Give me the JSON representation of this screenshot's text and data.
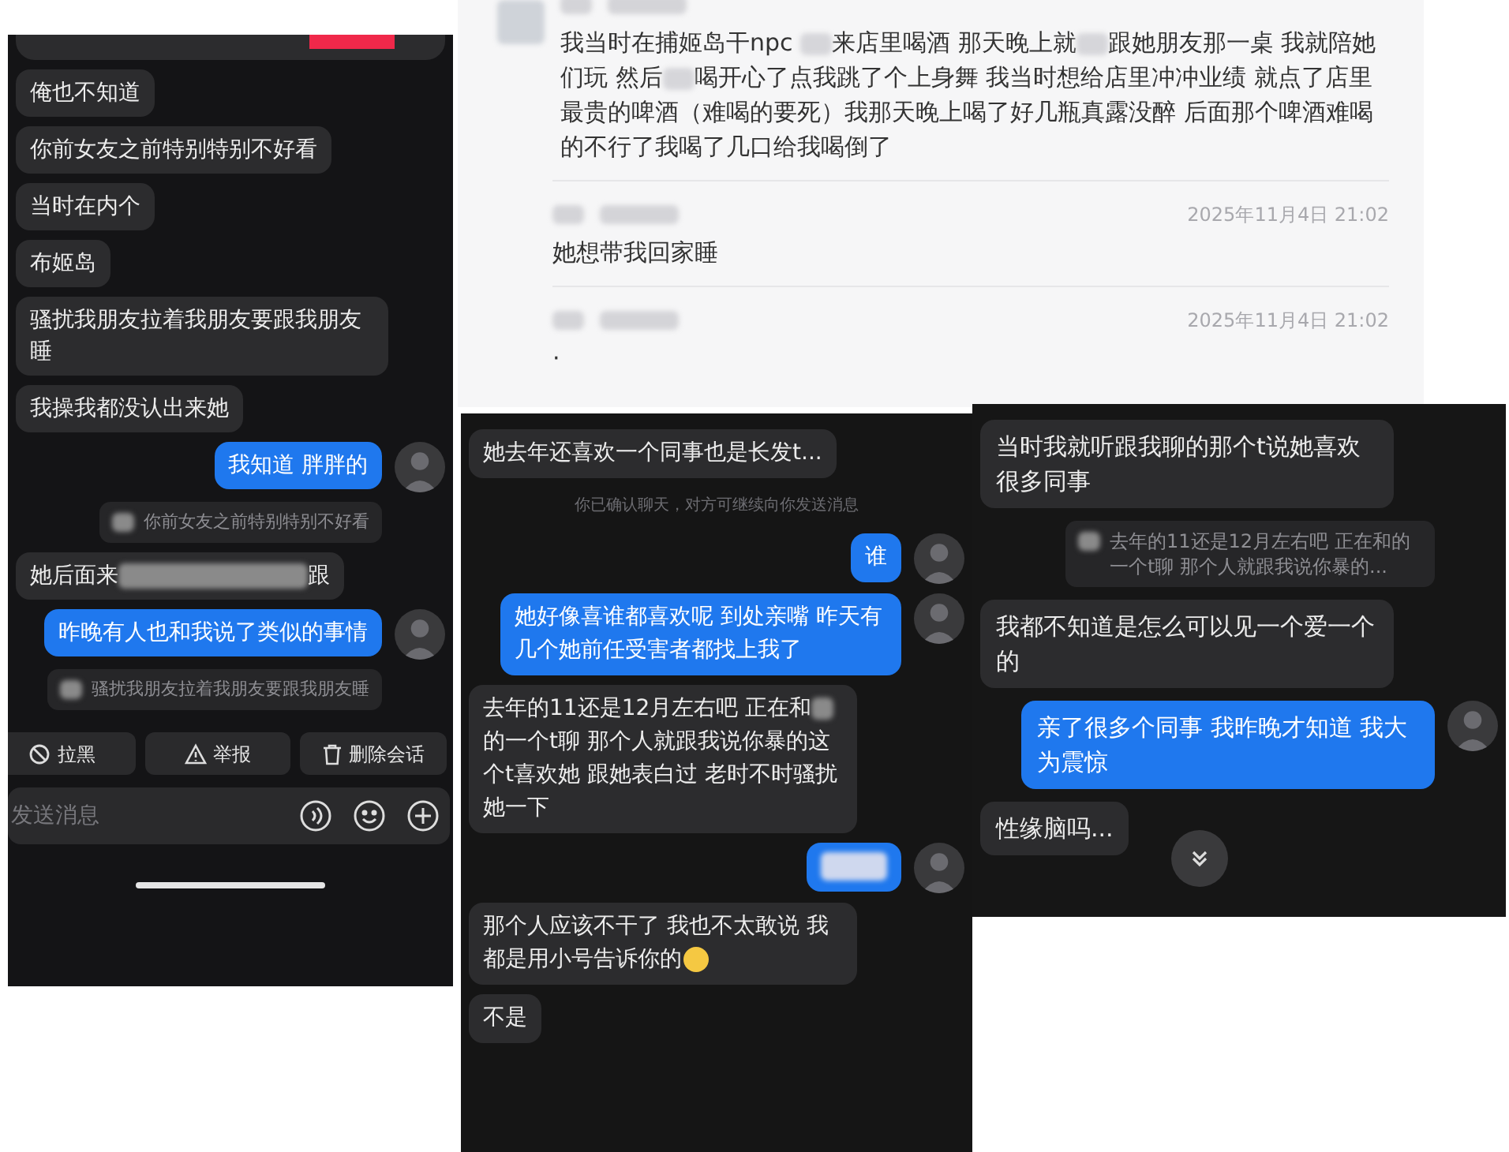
{
  "panels": [
    {
      "kind": "phone_chat",
      "messages": [
        {
          "kind": "cut_off"
        },
        {
          "kind": "incoming",
          "segments": [
            {
              "kind": "text",
              "text": "俺也不知道"
            }
          ]
        },
        {
          "kind": "incoming",
          "segments": [
            {
              "kind": "text",
              "text": "你前女友之前特别特别不好看"
            }
          ]
        },
        {
          "kind": "incoming",
          "segments": [
            {
              "kind": "text",
              "text": "当时在内个"
            }
          ]
        },
        {
          "kind": "incoming",
          "segments": [
            {
              "kind": "text",
              "text": "布姬岛"
            }
          ]
        },
        {
          "kind": "incoming",
          "segments": [
            {
              "kind": "text",
              "text": "骚扰我朋友拉着我朋友要跟我朋友睡"
            }
          ]
        },
        {
          "kind": "incoming",
          "segments": [
            {
              "kind": "text",
              "text": "我操我都没认出来她"
            }
          ]
        },
        {
          "kind": "outgoing",
          "segments": [
            {
              "kind": "text",
              "text": "我知道  胖胖的"
            }
          ]
        },
        {
          "kind": "quote",
          "segments": [
            {
              "kind": "text",
              "text": "你前女友之前特别特别不好看"
            }
          ]
        },
        {
          "kind": "incoming",
          "segments": [
            {
              "kind": "text",
              "text": "她后面来"
            },
            {
              "kind": "redacted"
            },
            {
              "kind": "text",
              "text": "跟"
            }
          ]
        },
        {
          "kind": "outgoing",
          "segments": [
            {
              "kind": "text",
              "text": "昨晚有人也和我说了类似的事情"
            }
          ]
        },
        {
          "kind": "quote",
          "segments": [
            {
              "kind": "text",
              "text": "骚扰我朋友拉着我朋友要跟我朋友睡"
            }
          ]
        }
      ],
      "actions": [
        {
          "kind": "block",
          "label": "拉黑"
        },
        {
          "kind": "report",
          "label": "举报"
        },
        {
          "kind": "delete",
          "label": "删除会话"
        }
      ],
      "input": {
        "placeholder": "发送消息"
      }
    },
    {
      "kind": "comments",
      "comments": [
        {
          "segments": [
            {
              "kind": "text",
              "text": "我当时在捕姬岛干npc "
            },
            {
              "kind": "redacted"
            },
            {
              "kind": "text",
              "text": "来店里喝酒 那天晚上就"
            },
            {
              "kind": "redacted"
            },
            {
              "kind": "text",
              "text": "跟她朋友那一桌 我就陪她们玩 然后"
            },
            {
              "kind": "redacted"
            },
            {
              "kind": "text",
              "text": "喝开心了点我跳了个上身舞 我当时想给店里冲冲业绩 就点了店里最贵的啤酒（难喝的要死）我那天晚上喝了好几瓶真露没醉 后面那个啤酒难喝的不行了我喝了几口给我喝倒了"
            }
          ]
        },
        {
          "timestamp": "2025年11月4日 21:02",
          "segments": [
            {
              "kind": "text",
              "text": "她想带我回家睡"
            }
          ]
        },
        {
          "timestamp": "2025年11月4日 21:02",
          "segments": [
            {
              "kind": "text",
              "text": "·"
            }
          ]
        }
      ]
    },
    {
      "kind": "chat",
      "messages": [
        {
          "kind": "incoming",
          "segments": [
            {
              "kind": "text",
              "text": "她去年还喜欢一个同事也是长发t..."
            }
          ]
        },
        {
          "kind": "system",
          "segments": [
            {
              "kind": "text",
              "text": "你已确认聊天，对方可继续向你发送消息"
            }
          ]
        },
        {
          "kind": "outgoing",
          "segments": [
            {
              "kind": "text",
              "text": "谁"
            }
          ]
        },
        {
          "kind": "outgoing",
          "segments": [
            {
              "kind": "text",
              "text": "她好像喜谁都喜欢呢  到处亲嘴  昨天有几个她前任受害者都找上我了"
            }
          ]
        },
        {
          "kind": "incoming",
          "segments": [
            {
              "kind": "text",
              "text": "去年的11还是12月左右吧 正在和"
            },
            {
              "kind": "redacted"
            },
            {
              "kind": "text",
              "text": "的一个t聊 那个人就跟我说你暴的这个t喜欢她 跟她表白过 老时不时骚扰她一下"
            }
          ]
        },
        {
          "kind": "outgoing",
          "segments": [
            {
              "kind": "redacted"
            }
          ]
        },
        {
          "kind": "incoming",
          "segments": [
            {
              "kind": "text",
              "text": "那个人应该不干了 我也不太敢说 我都是用小号告诉你的"
            }
          ],
          "emoji": true
        },
        {
          "kind": "incoming",
          "segments": [
            {
              "kind": "text",
              "text": "不是"
            }
          ]
        }
      ]
    },
    {
      "kind": "chat",
      "messages": [
        {
          "kind": "incoming",
          "segments": [
            {
              "kind": "text",
              "text": "当时我就听跟我聊的那个t说她喜欢很多同事"
            }
          ]
        },
        {
          "kind": "quote",
          "segments": [
            {
              "kind": "text",
              "text": "去年的11还是12月左右吧 正在和的一个t聊 那个人就跟我说你暴的..."
            }
          ]
        },
        {
          "kind": "incoming",
          "segments": [
            {
              "kind": "text",
              "text": "我都不知道是怎么可以见一个爱一个的"
            }
          ]
        },
        {
          "kind": "outgoing",
          "segments": [
            {
              "kind": "text",
              "text": "亲了很多个同事 我昨晚才知道  我大为震惊"
            }
          ]
        },
        {
          "kind": "incoming",
          "segments": [
            {
              "kind": "text",
              "text": "性缘脑吗..."
            }
          ]
        }
      ],
      "scroll_down": true
    }
  ]
}
